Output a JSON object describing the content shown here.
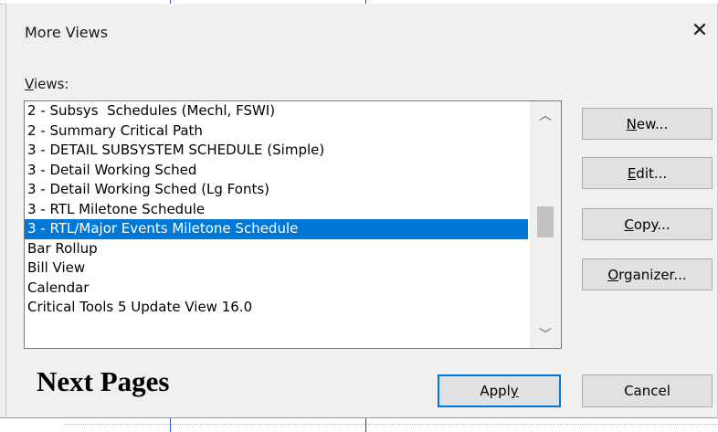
{
  "dialog": {
    "title": "More Views",
    "close_glyph": "✕",
    "views_label": "Views:",
    "views_label_underline": "V",
    "views_label_rest": "iews:"
  },
  "list": {
    "items": [
      "2 - Subsys  Schedules (Mechl, FSWI)",
      "2 - Summary Critical Path",
      "3 - DETAIL SUBSYSTEM SCHEDULE (Simple)",
      "3 - Detail Working Sched",
      "3 - Detail Working Sched (Lg Fonts)",
      "3 - RTL Miletone Schedule",
      "3 - RTL/Major Events Miletone Schedule",
      "Bar Rollup",
      "Bill View",
      "Calendar",
      "Critical Tools 5 Update View 16.0"
    ],
    "selected_index": 6,
    "scroll_up_glyph": "︿",
    "scroll_down_glyph": "﹀"
  },
  "buttons": {
    "new": {
      "acc": "N",
      "rest": "ew..."
    },
    "edit": {
      "acc": "E",
      "rest": "dit..."
    },
    "copy": {
      "acc": "C",
      "rest": "opy..."
    },
    "organizer": {
      "acc": "O",
      "rest": "rganizer..."
    },
    "apply": {
      "pre": "Appl",
      "acc": "y"
    },
    "cancel": "Cancel"
  },
  "overlay_text": "Next Pages",
  "colors": {
    "selection": "#0078d7",
    "default_button_border": "#0078d7"
  }
}
